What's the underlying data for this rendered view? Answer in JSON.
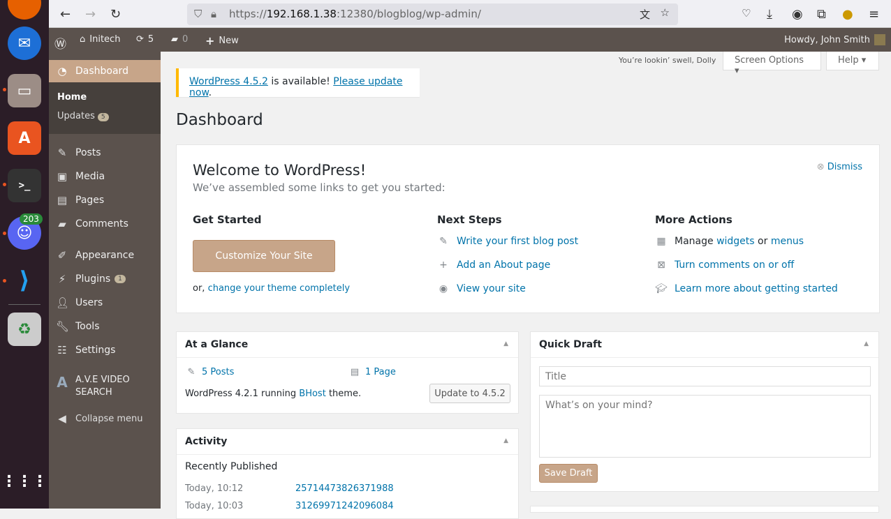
{
  "dock": {
    "discord_badge": "203"
  },
  "browser": {
    "url_prefix": "https://",
    "url_host": "192.168.1.38",
    "url_rest": ":12380/blogblog/wp-admin/"
  },
  "adminbar": {
    "site": "Initech",
    "updates": "5",
    "comments": "0",
    "new": "New",
    "howdy": "Howdy, John Smith"
  },
  "sidebar": {
    "dashboard": "Dashboard",
    "home": "Home",
    "updates": "Updates",
    "updates_count": "5",
    "items": [
      {
        "label": "Posts"
      },
      {
        "label": "Media"
      },
      {
        "label": "Pages"
      },
      {
        "label": "Comments"
      },
      {
        "label": "Appearance"
      },
      {
        "label": "Plugins",
        "badge": "1"
      },
      {
        "label": "Users"
      },
      {
        "label": "Tools"
      },
      {
        "label": "Settings"
      },
      {
        "label": "A.V.E VIDEO SEARCH"
      }
    ],
    "collapse": "Collapse menu"
  },
  "top": {
    "dolly": "You’re lookin’ swell, Dolly",
    "screen_options": "Screen Options",
    "help": "Help"
  },
  "notice": {
    "version_link": "WordPress 4.5.2",
    "mid": " is available! ",
    "update_link": "Please update now",
    "end": "."
  },
  "page_title": "Dashboard",
  "welcome": {
    "title": "Welcome to WordPress!",
    "subtitle": "We’ve assembled some links to get you started:",
    "dismiss": "Dismiss",
    "get_started": "Get Started",
    "customize": "Customize Your Site",
    "or": "or, ",
    "change_theme": "change your theme completely",
    "next_steps": "Next Steps",
    "next": [
      "Write your first blog post",
      "Add an About page",
      "View your site"
    ],
    "more_actions": "More Actions",
    "manage": "Manage ",
    "widgets": "widgets",
    "or2": " or ",
    "menus": "menus",
    "comments_toggle": "Turn comments on or off",
    "learn": "Learn more about getting started"
  },
  "glance": {
    "title": "At a Glance",
    "posts": "5 Posts",
    "pages": "1 Page",
    "running_pre": "WordPress 4.2.1 running ",
    "theme": "BHost",
    "running_post": " theme.",
    "update_btn": "Update to 4.5.2"
  },
  "activity": {
    "title": "Activity",
    "recent": "Recently Published",
    "items": [
      {
        "time": "Today, 10:12",
        "title": "25714473826371988"
      },
      {
        "time": "Today, 10:03",
        "title": "31269971242096084"
      }
    ]
  },
  "draft": {
    "title": "Quick Draft",
    "title_ph": "Title",
    "content_ph": "What’s on your mind?",
    "save": "Save Draft"
  }
}
